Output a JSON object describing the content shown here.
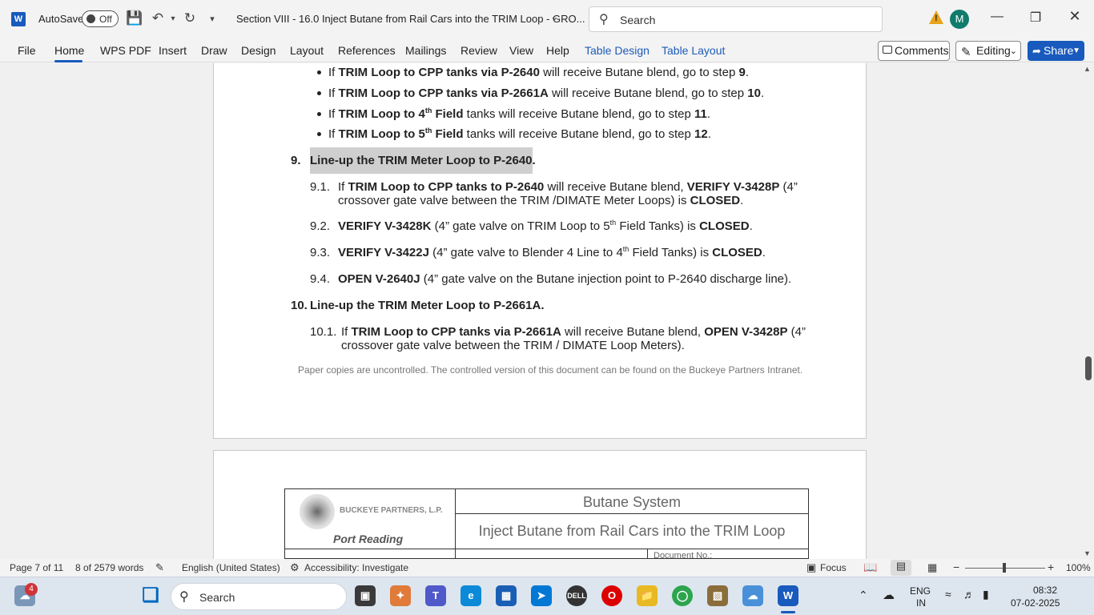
{
  "titlebar": {
    "app_logo": "W",
    "autosave_label": "AutoSave",
    "autosave_state": "Off",
    "document_title": "Section VIII - 16.0 Inject Butane from Rail Cars into the TRIM Loop - GRO...",
    "search_placeholder": "Search",
    "avatar_initial": "M"
  },
  "ribbon": {
    "tabs": [
      "File",
      "Home",
      "WPS PDF",
      "Insert",
      "Draw",
      "Design",
      "Layout",
      "References",
      "Mailings",
      "Review",
      "View",
      "Help",
      "Table Design",
      "Table Layout"
    ],
    "active_tab": "Home",
    "comments_label": "Comments",
    "editing_label": "Editing",
    "share_label": "Share"
  },
  "document": {
    "bullets": [
      {
        "pre": "If ",
        "bold": "TRIM Loop to CPP tanks via P-2640",
        "post": " will receive Butane blend, go to step ",
        "step": "9",
        "end": "."
      },
      {
        "pre": "If ",
        "bold": "TRIM Loop to CPP tanks via P-2661A",
        "post": " will receive Butane blend, go to step ",
        "step": "10",
        "end": "."
      },
      {
        "pre": "If ",
        "bold_a": "TRIM Loop to 4",
        "sup": "th",
        "bold_b": " Field",
        "post": " tanks will receive Butane blend, go to step ",
        "step": "11",
        "end": "."
      },
      {
        "pre": "If ",
        "bold_a": "TRIM Loop to 5",
        "sup": "th",
        "bold_b": " Field",
        "post": " tanks will receive Butane blend, go to step ",
        "step": "12",
        "end": "."
      }
    ],
    "step9": {
      "num": "9.",
      "title": "Line-up the TRIM Meter Loop to P-2640",
      "end": "."
    },
    "s91": {
      "num": "9.1.",
      "pre": "If ",
      "b1": "TRIM Loop to CPP tanks to P-2640",
      "mid": " will receive Butane blend, ",
      "b2": "VERIFY V-3428P",
      "post": " (4”",
      "line2_pre": "crossover gate valve between the TRIM /DIMATE Meter Loops) is ",
      "line2_b": "CLOSED",
      "line2_end": "."
    },
    "s92": {
      "num": "9.2.",
      "b1": "VERIFY V-3428K",
      "pre": " (4” gate valve on TRIM Loop to 5",
      "sup": "th",
      "post": " Field Tanks) is ",
      "b2": "CLOSED",
      "end": "."
    },
    "s93": {
      "num": "9.3.",
      "b1": "VERIFY V-3422J",
      "pre": " (4” gate valve to Blender 4 Line to 4",
      "sup": "th",
      "post": " Field Tanks) is ",
      "b2": "CLOSED",
      "end": "."
    },
    "s94": {
      "num": "9.4.",
      "b1": "OPEN V-2640J",
      "post": " (4” gate valve on the Butane injection point to P-2640 discharge line)."
    },
    "step10": {
      "num": "10.",
      "title": "Line-up the TRIM Meter Loop to P-2661A."
    },
    "s101": {
      "num": "10.1.",
      "pre": "If ",
      "b1": "TRIM Loop to CPP tanks via P-2661A",
      "mid": " will receive Butane blend, ",
      "b2": "OPEN V-3428P",
      "post": " (4”",
      "line2": "crossover gate valve between the TRIM / DIMATE Loop Meters)."
    },
    "footer_note": "Paper copies are uncontrolled. The controlled version of this document can be found on the Buckeye Partners Intranet.",
    "header_table": {
      "company": "BUCKEYE PARTNERS, L.P.",
      "location": "Port Reading",
      "system": "Butane System",
      "procedure": "Inject Butane from Rail Cars into the TRIM Loop",
      "doc_no_label": "Document No.:"
    }
  },
  "statusbar": {
    "page": "Page 7 of 11",
    "words": "8 of 2579 words",
    "language": "English (United States)",
    "accessibility": "Accessibility: Investigate",
    "focus": "Focus",
    "zoom": "100%"
  },
  "taskbar": {
    "widget_badge": "4",
    "search_label": "Search",
    "lang_line1": "ENG",
    "lang_line2": "IN",
    "time": "08:32",
    "date": "07-02-2025"
  },
  "colors": {
    "accent": "#185abd",
    "table_tab": "#1d5bb8",
    "highlight": "#cfcfcf"
  },
  "icons": [
    "word-logo-icon",
    "save-icon",
    "undo-icon",
    "redo-icon",
    "customize-icon",
    "search-icon",
    "warning-icon",
    "minimize-icon",
    "maximize-icon",
    "close-icon",
    "comments-icon",
    "pencil-icon",
    "share-icon"
  ]
}
